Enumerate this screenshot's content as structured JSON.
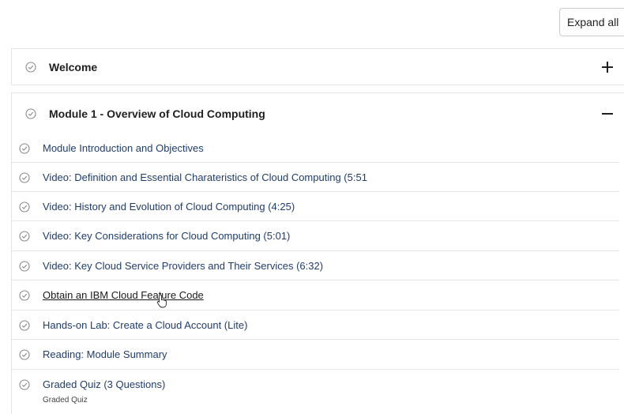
{
  "toolbar": {
    "expand_label": "Expand all"
  },
  "sections": [
    {
      "title": "Welcome",
      "state": "collapsed"
    },
    {
      "title": "Module 1 - Overview of Cloud Computing",
      "state": "expanded"
    }
  ],
  "module1": {
    "items": [
      {
        "label": "Module Introduction and Objectives"
      },
      {
        "label": "Video: Definition and Essential Charateristics of Cloud Computing (5:51"
      },
      {
        "label": "Video: History and Evolution of Cloud Computing (4:25)"
      },
      {
        "label": "Video: Key Considerations for Cloud Computing (5:01)"
      },
      {
        "label": "Video: Key Cloud Service Providers and Their Services (6:32)"
      },
      {
        "label": "Obtain an IBM Cloud Feature Code"
      },
      {
        "label": "Hands-on Lab: Create a Cloud Account (Lite)"
      },
      {
        "label": "Reading: Module Summary"
      },
      {
        "label": "Graded Quiz (3 Questions)",
        "sublabel": "Graded Quiz"
      }
    ]
  },
  "colors": {
    "link": "#1f3d6b",
    "check": "#8a8a8a",
    "border": "#e4e4e4"
  },
  "icons": {
    "item_status": "check-circle-icon",
    "expand": "plus-icon",
    "collapse": "minus-icon"
  }
}
